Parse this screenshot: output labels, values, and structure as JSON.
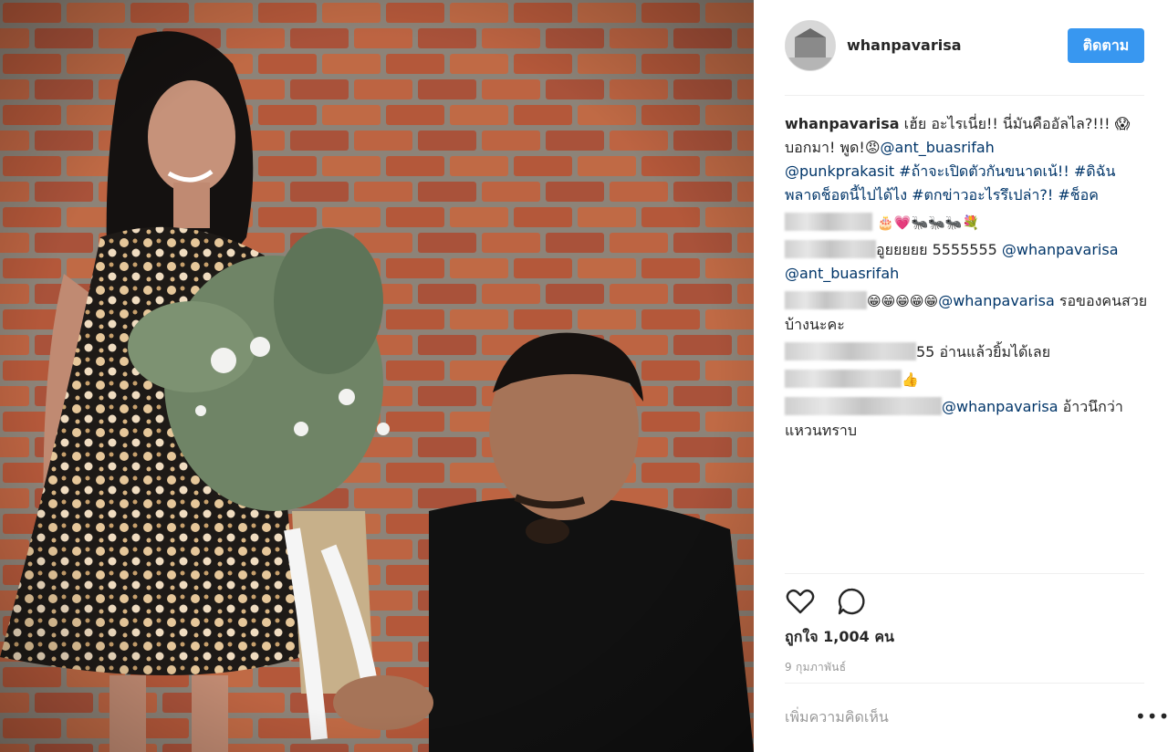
{
  "post": {
    "username": "whanpavarisa",
    "follow_label": "ติดตาม",
    "caption": {
      "username": "whanpavarisa",
      "text1": " เฮ้ย อะไรเนี่ย!! นี่มันคืออัลไล?!!! ",
      "emoji1": "😱",
      "text2": "บอกมา! พูด!",
      "emoji2": "😡",
      "mention1": "@ant_buasrifah",
      "mention2": "@punkprakasit",
      "tag1": " #ถ้าจะเปิดตัวกันขนาดเน้!! ",
      "tag2": "#ดิฉันพลาดช็อตนี้ไปได้ไง",
      "tag3": " #ตกข่าวอะไรรึเปล่า?!",
      "tag4": " #ช็อค"
    },
    "comments": [
      {
        "text": "🎂💗🐜🐜🐜💐"
      },
      {
        "text": "อูยยยยย 5555555 ",
        "mention": "@whanpavarisa",
        "mention2": "@ant_buasrifah"
      },
      {
        "emoji": "😁😁😁😁😁",
        "mention": "@whanpavarisa",
        "text": " รอของคนสวยบ้างนะคะ"
      },
      {
        "text": "55 อ่านแล้วยิ้มได้เลย"
      },
      {
        "text": "👍"
      },
      {
        "mention": "@whanpavarisa",
        "text": " อ้าวนึกว่าแหวนทราบ"
      }
    ],
    "likes_label": "ถูกใจ 1,004 คน",
    "date": "9 กุมภาพันธ์",
    "add_comment_placeholder": "เพิ่มความคิดเห็น",
    "more_label": "•••"
  },
  "icons": {
    "like": "heart-outline-icon",
    "comment": "speech-bubble-icon"
  },
  "colors": {
    "follow_button": "#3897f0",
    "link": "#003569",
    "muted": "#999999"
  }
}
